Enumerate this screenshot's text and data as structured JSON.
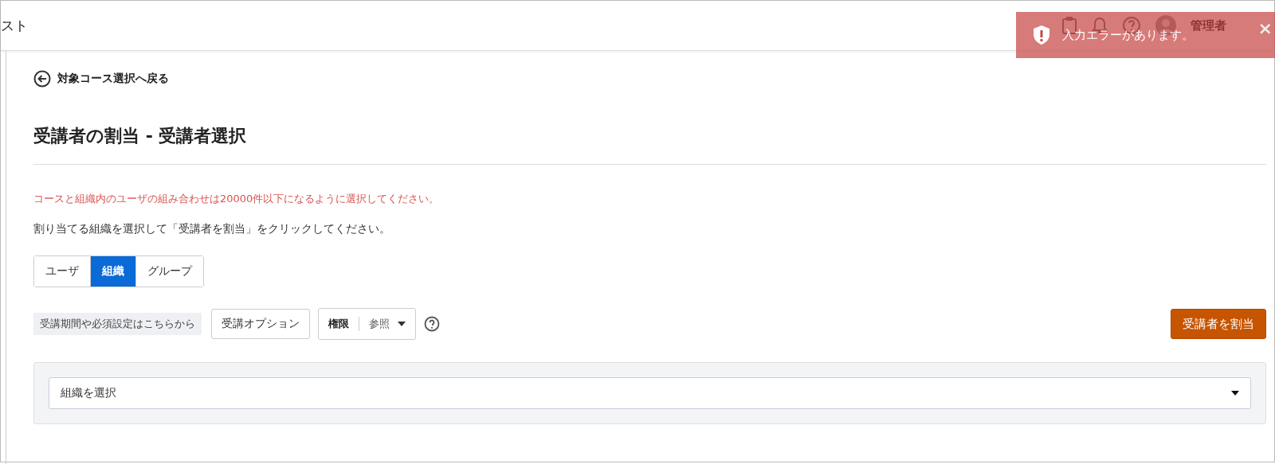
{
  "header": {
    "title": "スト",
    "user": "管理者"
  },
  "toast": {
    "message": "入力エラーがあります。",
    "close": "×"
  },
  "back_link": "対象コース選択へ戻る",
  "page_title": "受講者の割当 - 受講者選択",
  "error_message": "コースと組織内のユーザの組み合わせは20000件以下になるように選択してください。",
  "instruction": "割り当てる組織を選択して「受講者を割当」をクリックしてください。",
  "tabs": [
    {
      "label": "ユーザ",
      "selected": false
    },
    {
      "label": "組織",
      "selected": true
    },
    {
      "label": "グループ",
      "selected": false
    }
  ],
  "options_hint": "受講期間や必須設定はこちらから",
  "option_button": "受講オプション",
  "permission": {
    "label": "権限",
    "value": "参照"
  },
  "assign_button": "受講者を割当",
  "org_select": {
    "placeholder": "組織を選択"
  }
}
